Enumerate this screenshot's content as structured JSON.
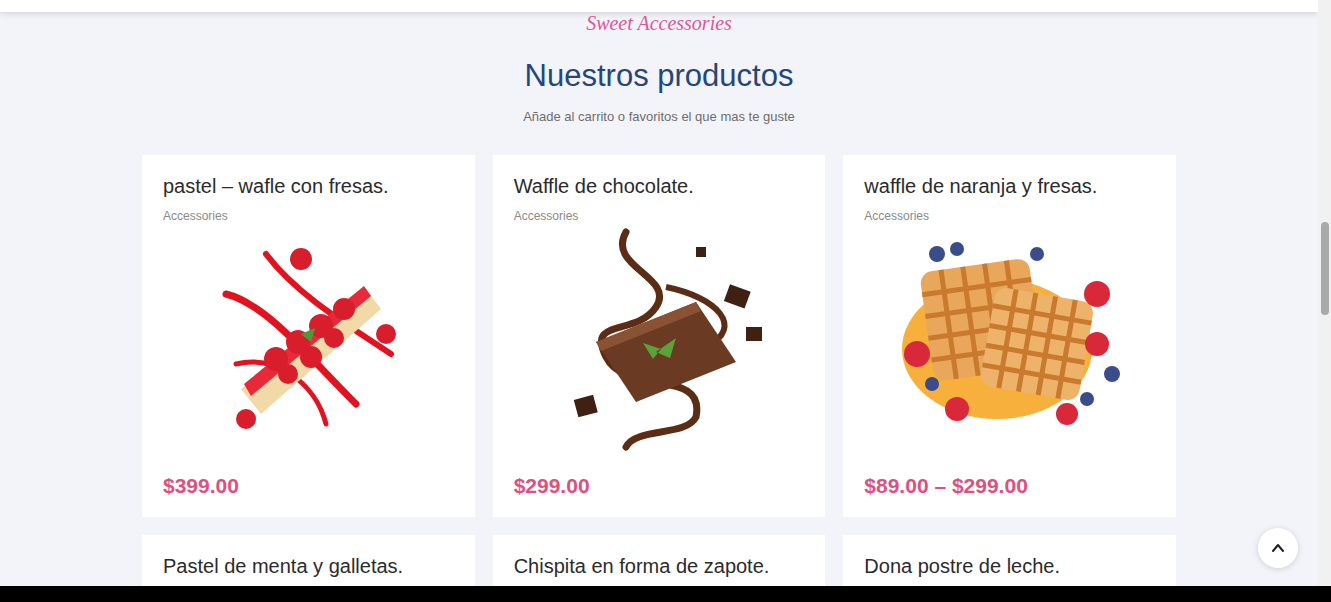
{
  "header": {
    "tagline": "Sweet Accessories",
    "title": "Nuestros productos",
    "subtitle": "Añade al carrito o favoritos el que mas te guste"
  },
  "products": [
    {
      "name": "pastel – wafle con fresas.",
      "category": "Accessories",
      "price": "$399.00",
      "kind": "cake"
    },
    {
      "name": "Waffle de chocolate.",
      "category": "Accessories",
      "price": "$299.00",
      "kind": "brownie"
    },
    {
      "name": "waffle de naranja y fresas.",
      "category": "Accessories",
      "price": "$89.00 – $299.00",
      "kind": "waffle"
    },
    {
      "name": "Pastel de menta y galletas.",
      "kind": "plain"
    },
    {
      "name": "Chispita en forma de zapote.",
      "kind": "plain"
    },
    {
      "name": "Dona postre de leche.",
      "kind": "plain"
    }
  ]
}
